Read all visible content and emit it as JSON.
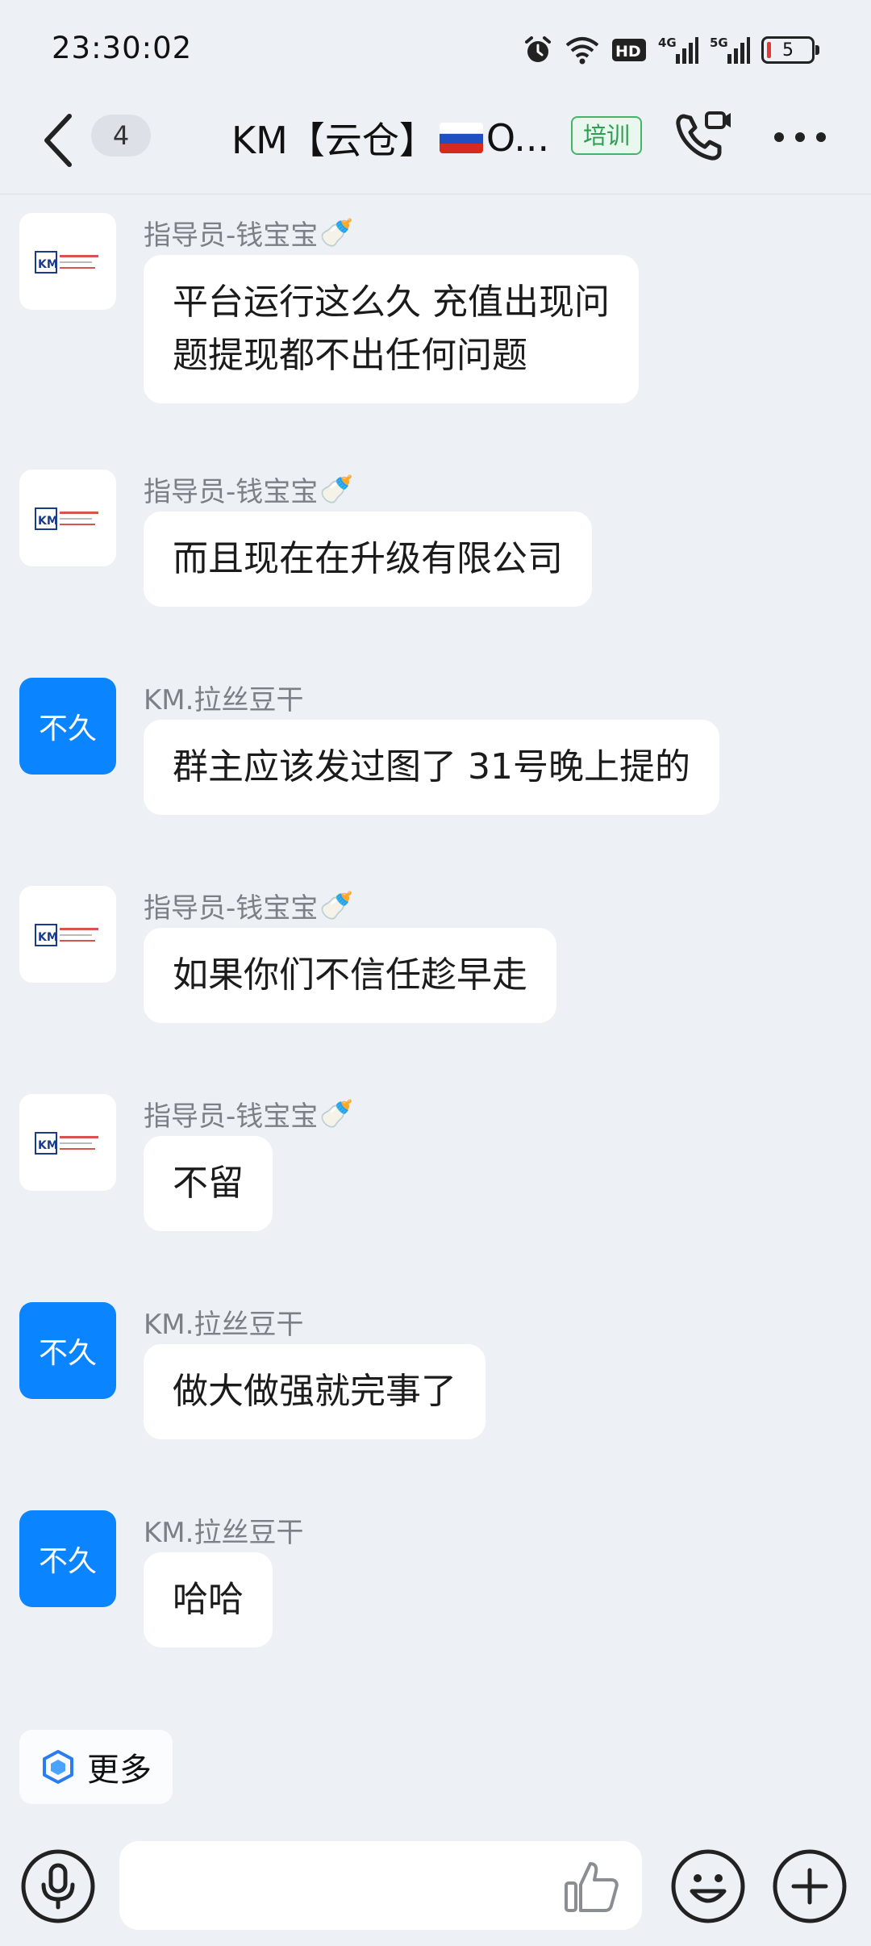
{
  "status_bar": {
    "time": "23:30:02",
    "network_4g": "4G",
    "network_5g": "5G",
    "hd_label": "HD",
    "battery_level": "5",
    "icons": [
      "alarm-icon",
      "wifi-icon",
      "hd-icon",
      "signal-4g-icon",
      "signal-5g-icon",
      "battery-icon"
    ]
  },
  "header": {
    "unread_count": "4",
    "title_prefix": "KM【云仓】",
    "title_suffix": "O...",
    "flag": "russia-flag",
    "tag": "培训",
    "icons": [
      "back-icon",
      "video-call-icon",
      "more-icon"
    ]
  },
  "messages": [
    {
      "sender": "指导员-钱宝宝",
      "sender_icon": "baby-bottle-icon",
      "avatar": "km-logo",
      "text": "平台运行这么久 充值出现问题提现都不出任何问题"
    },
    {
      "sender": "指导员-钱宝宝",
      "sender_icon": "baby-bottle-icon",
      "avatar": "km-logo",
      "text": "而且现在在升级有限公司"
    },
    {
      "sender": "KM.拉丝豆干",
      "avatar_text": "不久",
      "text": "群主应该发过图了 31号晚上提的"
    },
    {
      "sender": "指导员-钱宝宝",
      "sender_icon": "baby-bottle-icon",
      "avatar": "km-logo",
      "text": "如果你们不信任趁早走"
    },
    {
      "sender": "指导员-钱宝宝",
      "sender_icon": "baby-bottle-icon",
      "avatar": "km-logo",
      "text": "不留"
    },
    {
      "sender": "KM.拉丝豆干",
      "avatar_text": "不久",
      "text": "做大做强就完事了"
    },
    {
      "sender": "KM.拉丝豆干",
      "avatar_text": "不久",
      "text": "哈哈"
    }
  ],
  "logo_text": "KM",
  "more_chip": {
    "label": "更多",
    "icon": "cube-icon"
  },
  "input_bar": {
    "placeholder": "",
    "icons": [
      "microphone-icon",
      "thumbs-up-icon",
      "emoji-icon",
      "plus-icon"
    ]
  },
  "colors": {
    "accent": "#0a84ff",
    "background": "#edf0f4",
    "tag_green": "#2f9e55"
  }
}
